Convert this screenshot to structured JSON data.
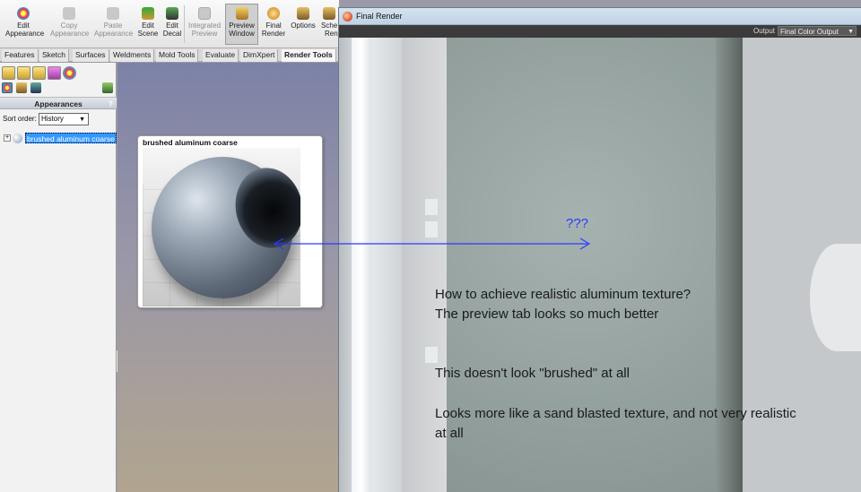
{
  "ribbon": {
    "buttons": [
      {
        "label1": "Edit",
        "label2": "Appearance",
        "disabled": false,
        "icon": "edit-appearance-icon"
      },
      {
        "label1": "Copy",
        "label2": "Appearance",
        "disabled": true,
        "icon": "copy-appearance-icon"
      },
      {
        "label1": "Paste",
        "label2": "Appearance",
        "disabled": true,
        "icon": "paste-appearance-icon"
      },
      {
        "label1": "Edit",
        "label2": "Scene",
        "disabled": false,
        "icon": "edit-scene-icon"
      },
      {
        "label1": "Edit",
        "label2": "Decal",
        "disabled": false,
        "icon": "edit-decal-icon"
      },
      {
        "label1": "Integrated",
        "label2": "Preview",
        "disabled": true,
        "icon": "integrated-preview-icon"
      },
      {
        "label1": "Preview",
        "label2": "Window",
        "disabled": false,
        "icon": "preview-window-icon"
      },
      {
        "label1": "Final",
        "label2": "Render",
        "disabled": false,
        "icon": "final-render-icon"
      },
      {
        "label1": "Options",
        "label2": "",
        "disabled": false,
        "icon": "options-icon"
      },
      {
        "label1": "Sche",
        "label2": "Ren",
        "disabled": false,
        "icon": "schedule-render-icon"
      }
    ]
  },
  "tabs": [
    "Features",
    "Sketch",
    "Surfaces",
    "Weldments",
    "Mold Tools",
    "Evaluate",
    "DimXpert",
    "Render Tools"
  ],
  "panel": {
    "header": "Appearances",
    "help": "?",
    "sort_label": "Sort order:",
    "sort_value": "History",
    "tree_item": "brushed aluminum coarse",
    "expand": "+"
  },
  "tooltip": {
    "title": "brushed aluminum coarse"
  },
  "final_render": {
    "title": "Final Render",
    "output_label": "Output",
    "output_value": "Final Color Output"
  },
  "annotation": {
    "question": "???",
    "line1": "How to achieve realistic aluminum texture?",
    "line2": "The preview tab looks so much better",
    "line3": "This doesn't look \"brushed\" at all",
    "line4": "Looks more like a sand blasted texture, and not very realistic",
    "line5": "at all"
  },
  "colors": {
    "annotation_arrow": "#2a3aff",
    "selection": "#3399ff"
  }
}
